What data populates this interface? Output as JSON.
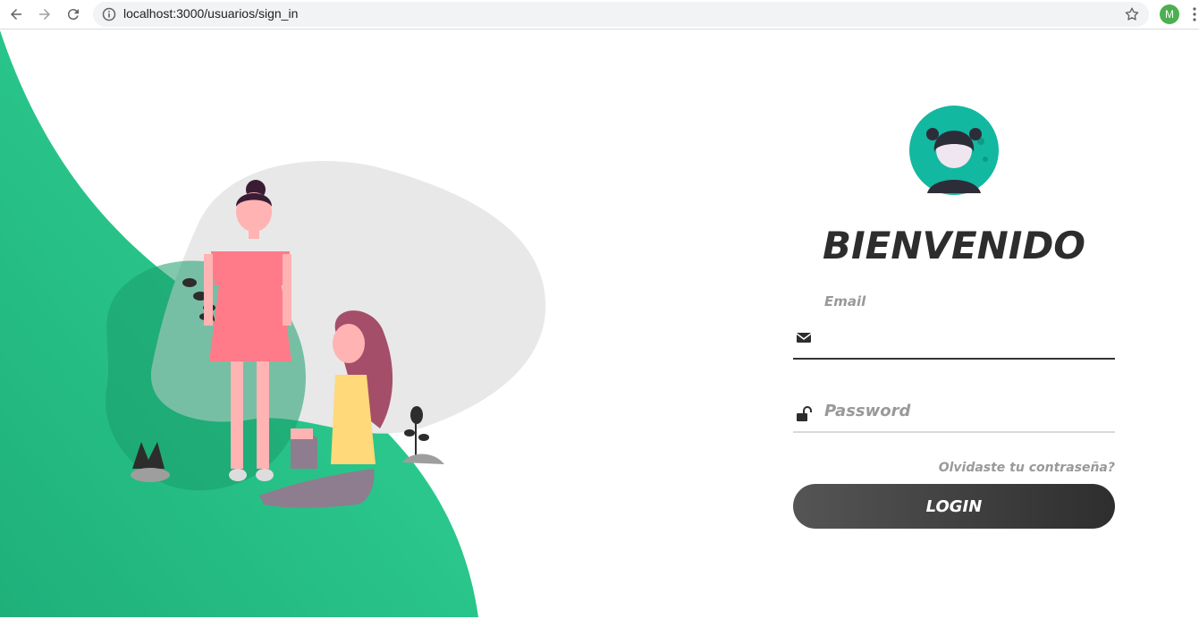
{
  "browser": {
    "url": "localhost:3000/usuarios/sign_in",
    "profile_initial": "M"
  },
  "colors": {
    "accent_green": "#2ed394",
    "dark": "#2d2d2d",
    "muted": "#999999"
  },
  "login": {
    "title": "BIENVENIDO",
    "email_label": "Email",
    "email_value": "",
    "password_placeholder": "Password",
    "forgot_link": "Olvidaste tu contraseña?",
    "login_button": "LOGIN"
  },
  "icons": {
    "back": "arrow-left-icon",
    "forward": "arrow-right-icon",
    "reload": "reload-icon",
    "info": "info-icon",
    "star": "star-icon",
    "menu": "kebab-menu-icon",
    "email": "envelope-icon",
    "password": "unlock-icon"
  }
}
